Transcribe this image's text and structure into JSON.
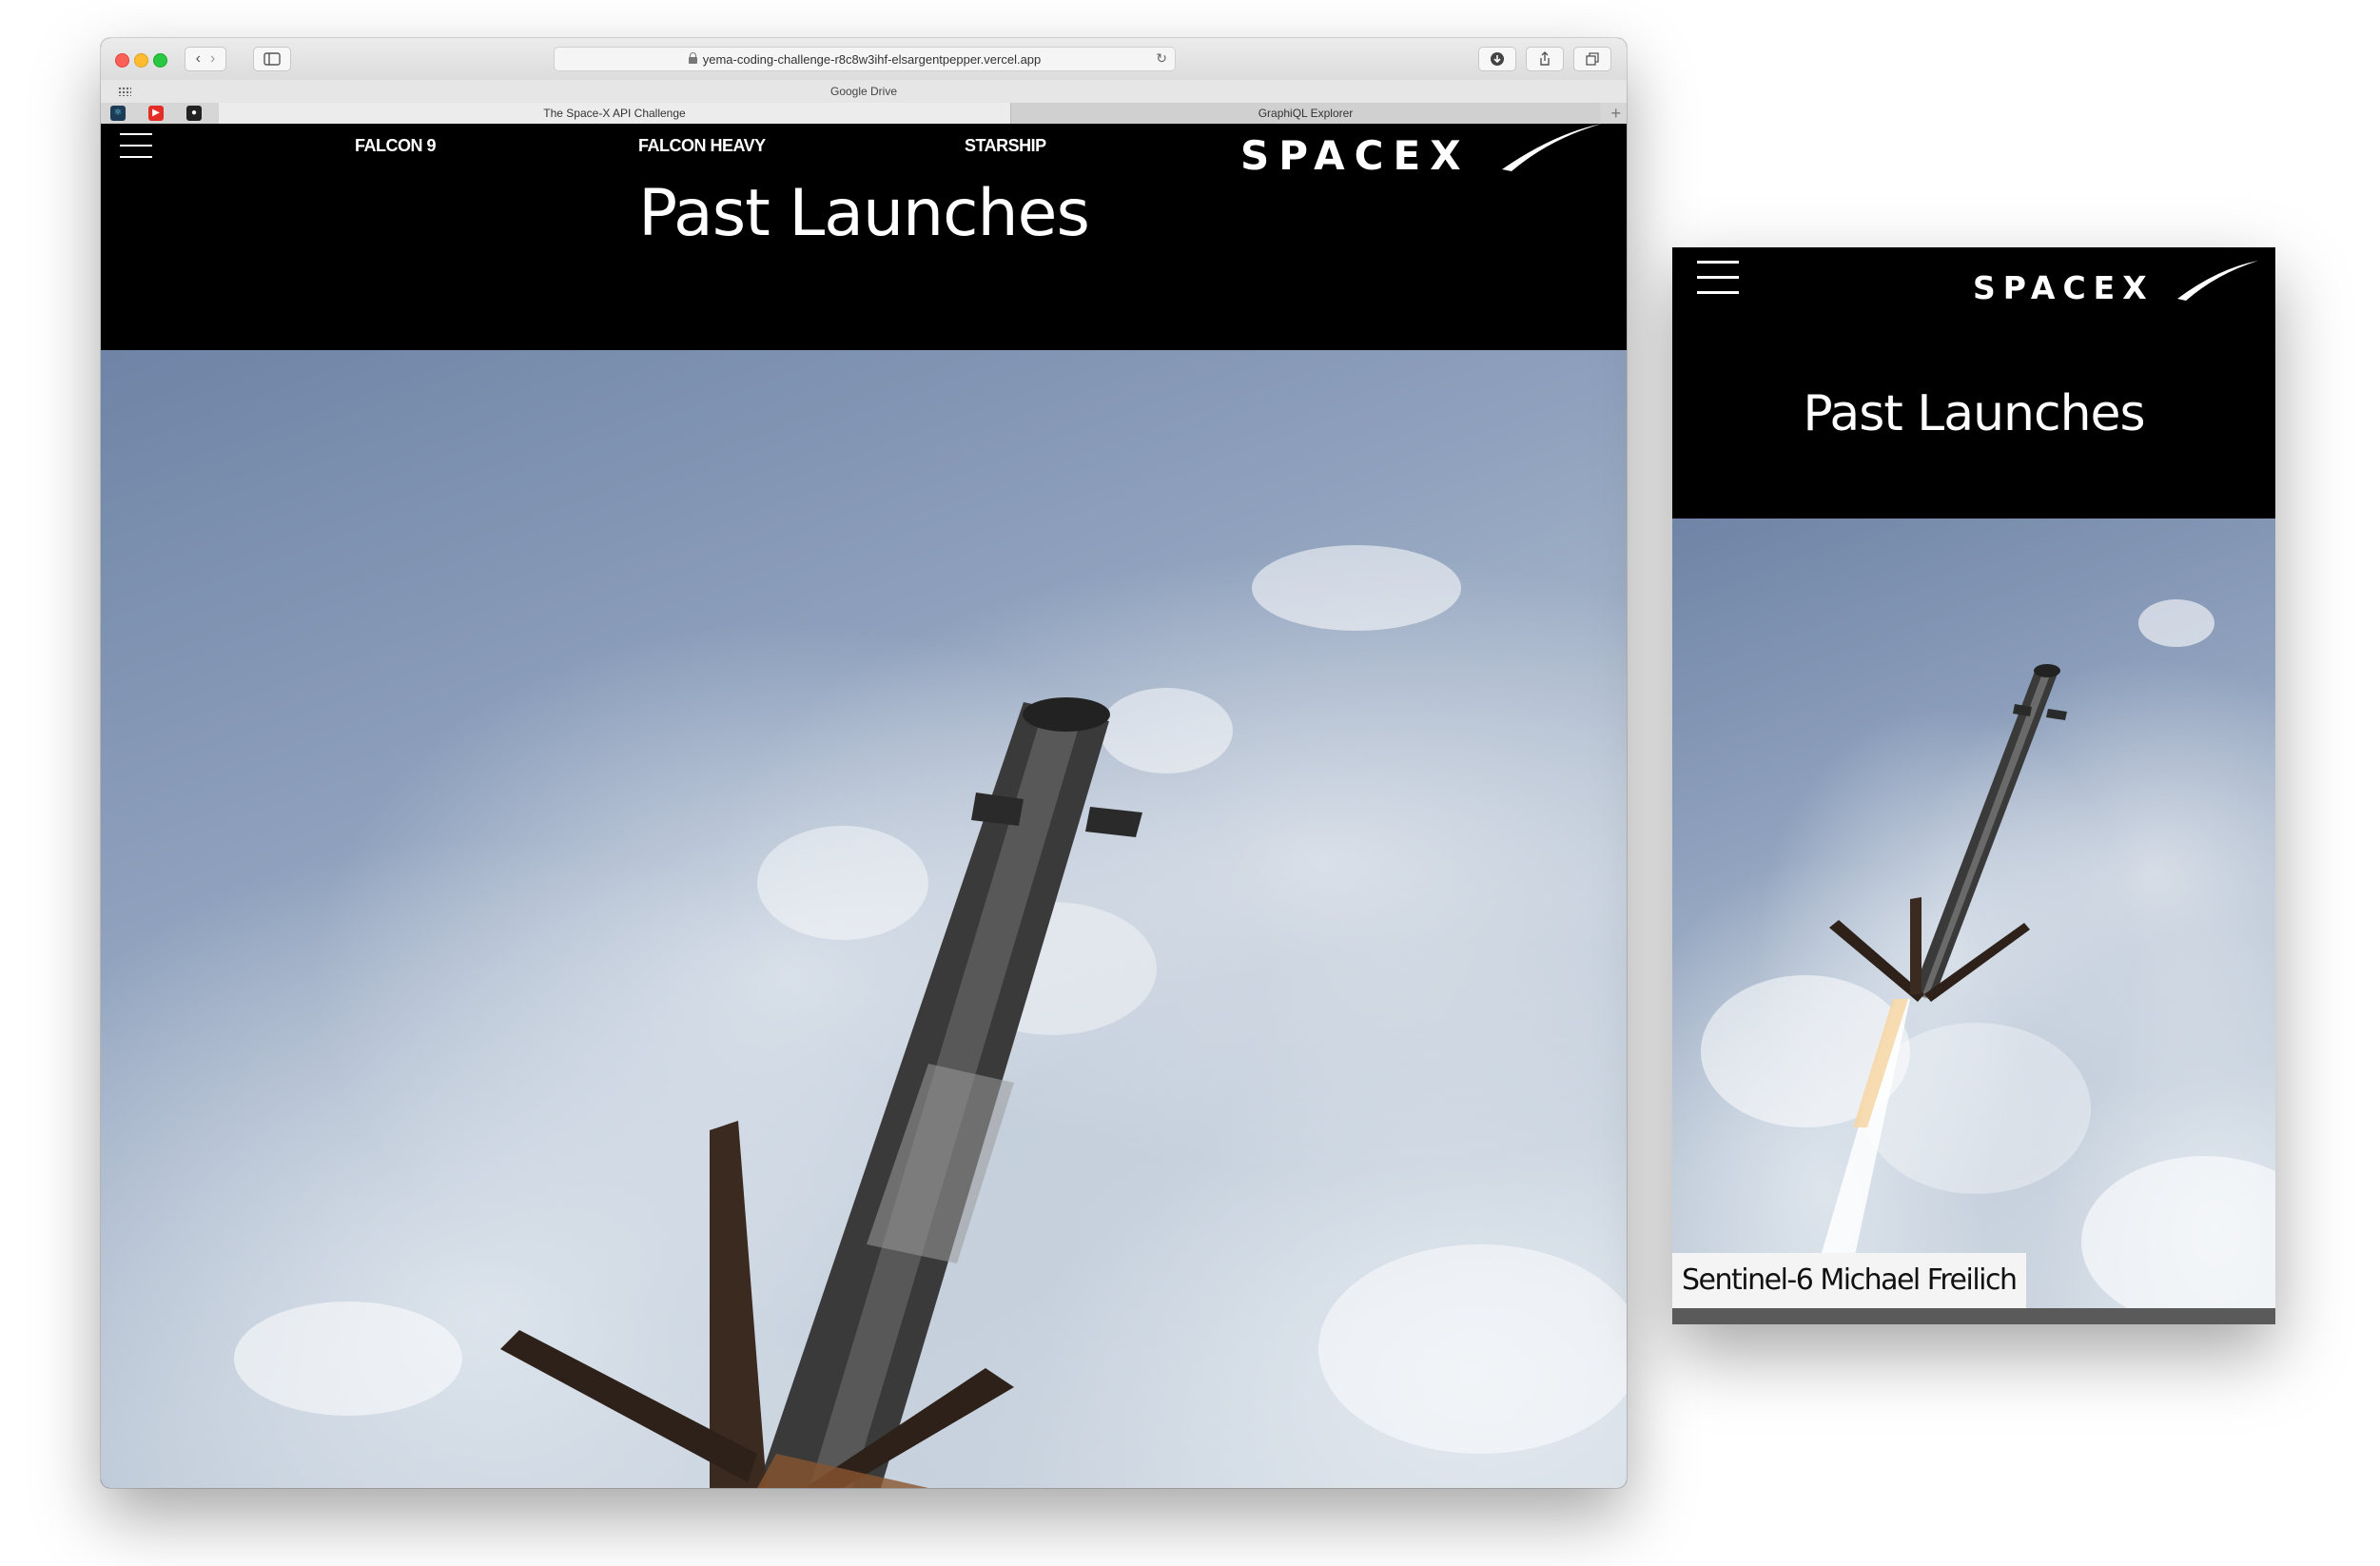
{
  "browser": {
    "url": "yema-coding-challenge-r8c8w3ihf-elsargentpepper.vercel.app",
    "favorites_bar_label": "Google Drive",
    "tabs": [
      {
        "label": "The Space-X API Challenge",
        "active": true
      },
      {
        "label": "GraphiQL Explorer",
        "active": false
      }
    ],
    "icons": [
      "back-icon",
      "forward-icon",
      "sidebar-icon",
      "lock-icon",
      "reload-icon",
      "download-icon",
      "share-icon",
      "tabs-overview-icon",
      "apps-grid-icon",
      "react-favicon",
      "youtube-favicon",
      "github-favicon",
      "new-tab-icon"
    ]
  },
  "site": {
    "nav": [
      "FALCON 9",
      "FALCON HEAVY",
      "STARSHIP"
    ],
    "logo_text": "SPACEX",
    "title": "Past Launches"
  },
  "mobile": {
    "title": "Past Launches",
    "caption": "Sentinel-6 Michael Freilich"
  },
  "colors": {
    "header_bg": "#000000",
    "text": "#ffffff",
    "sky_top": "#6f84a6",
    "sky_bottom": "#ccd5df"
  }
}
